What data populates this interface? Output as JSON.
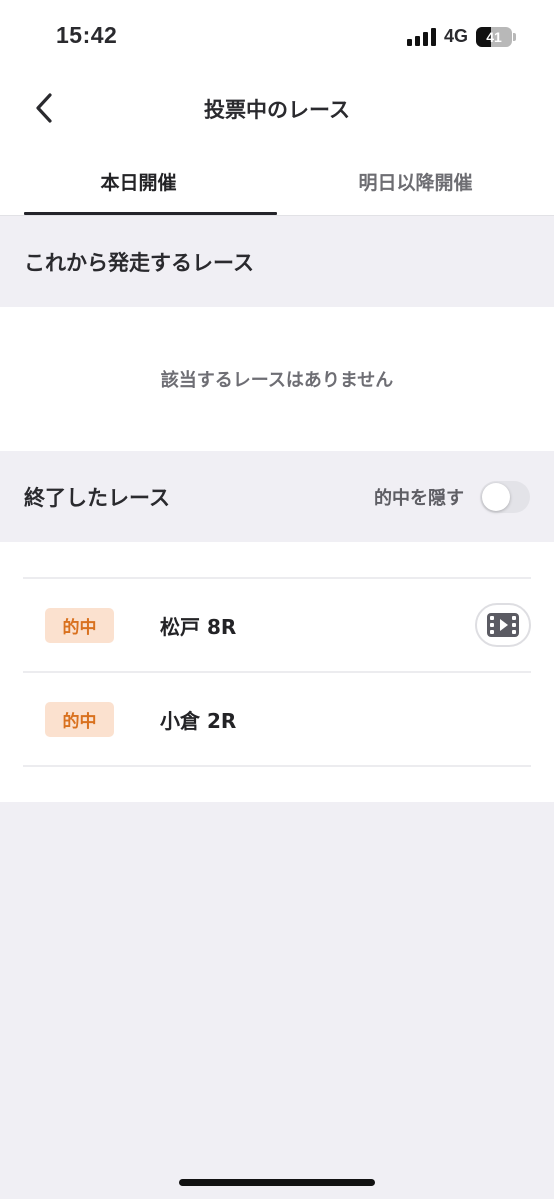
{
  "status_bar": {
    "time": "15:42",
    "network": "4G",
    "battery": "41",
    "battery_level_percent": 41
  },
  "nav": {
    "title": "投票中のレース",
    "back_icon": "chevron-left-icon"
  },
  "tabs": [
    {
      "label": "本日開催",
      "active": true
    },
    {
      "label": "明日以降開催",
      "active": false
    }
  ],
  "upcoming": {
    "title": "これから発走するレース",
    "empty_message": "該当するレースはありません"
  },
  "finished": {
    "title": "終了したレース",
    "hide_hits_label": "的中を隠す",
    "hide_hits_on": false,
    "races": [
      {
        "badge": "的中",
        "name": "松戸 8R",
        "has_video": true
      },
      {
        "badge": "的中",
        "name": "小倉 2R",
        "has_video": false
      }
    ]
  },
  "colors": {
    "background": "#f0eff4",
    "badge_bg": "#fbe1cf",
    "badge_text": "#d9711f",
    "tab_underline": "#24242a"
  }
}
